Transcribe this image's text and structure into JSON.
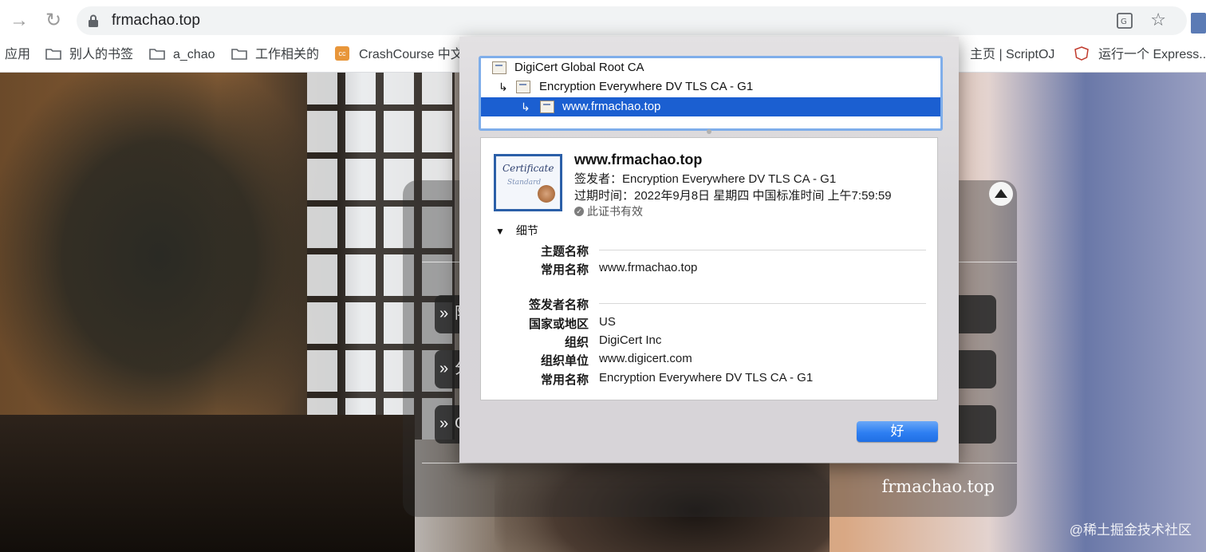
{
  "browser": {
    "url": "frmachao.top",
    "bookmarks": [
      "应用",
      "别人的书签",
      "a_chao",
      "工作相关的",
      "CrashCourse 中文",
      "主页 | ScriptOJ",
      "运行一个 Express..."
    ]
  },
  "site": {
    "row_arrow": "»",
    "row_initials": [
      "阿",
      "分",
      "G"
    ],
    "footer": "frmachao.top"
  },
  "cert_dialog": {
    "chain": [
      "DigiCert Global Root CA",
      "Encryption Everywhere DV TLS CA - G1",
      "www.frmachao.top"
    ],
    "cert_icon_text": [
      "Certificate",
      "Standard"
    ],
    "name": "www.frmachao.top",
    "issuer_line": "签发者：Encryption Everywhere DV TLS CA - G1",
    "expiry_line": "过期时间：2022年9月8日 星期四 中国标准时间 上午7:59:59",
    "valid_text": "此证书有效",
    "details_label": "细节",
    "subject_header": "主题名称",
    "subject_cn_key": "常用名称",
    "subject_cn_value": "www.frmachao.top",
    "issuer_header": "签发者名称",
    "issuer_fields": [
      {
        "key": "国家或地区",
        "value": "US"
      },
      {
        "key": "组织",
        "value": "DigiCert Inc"
      },
      {
        "key": "组织单位",
        "value": "www.digicert.com"
      },
      {
        "key": "常用名称",
        "value": "Encryption Everywhere DV TLS CA - G1"
      }
    ],
    "ok_label": "好"
  },
  "watermark": "@稀土掘金技术社区"
}
